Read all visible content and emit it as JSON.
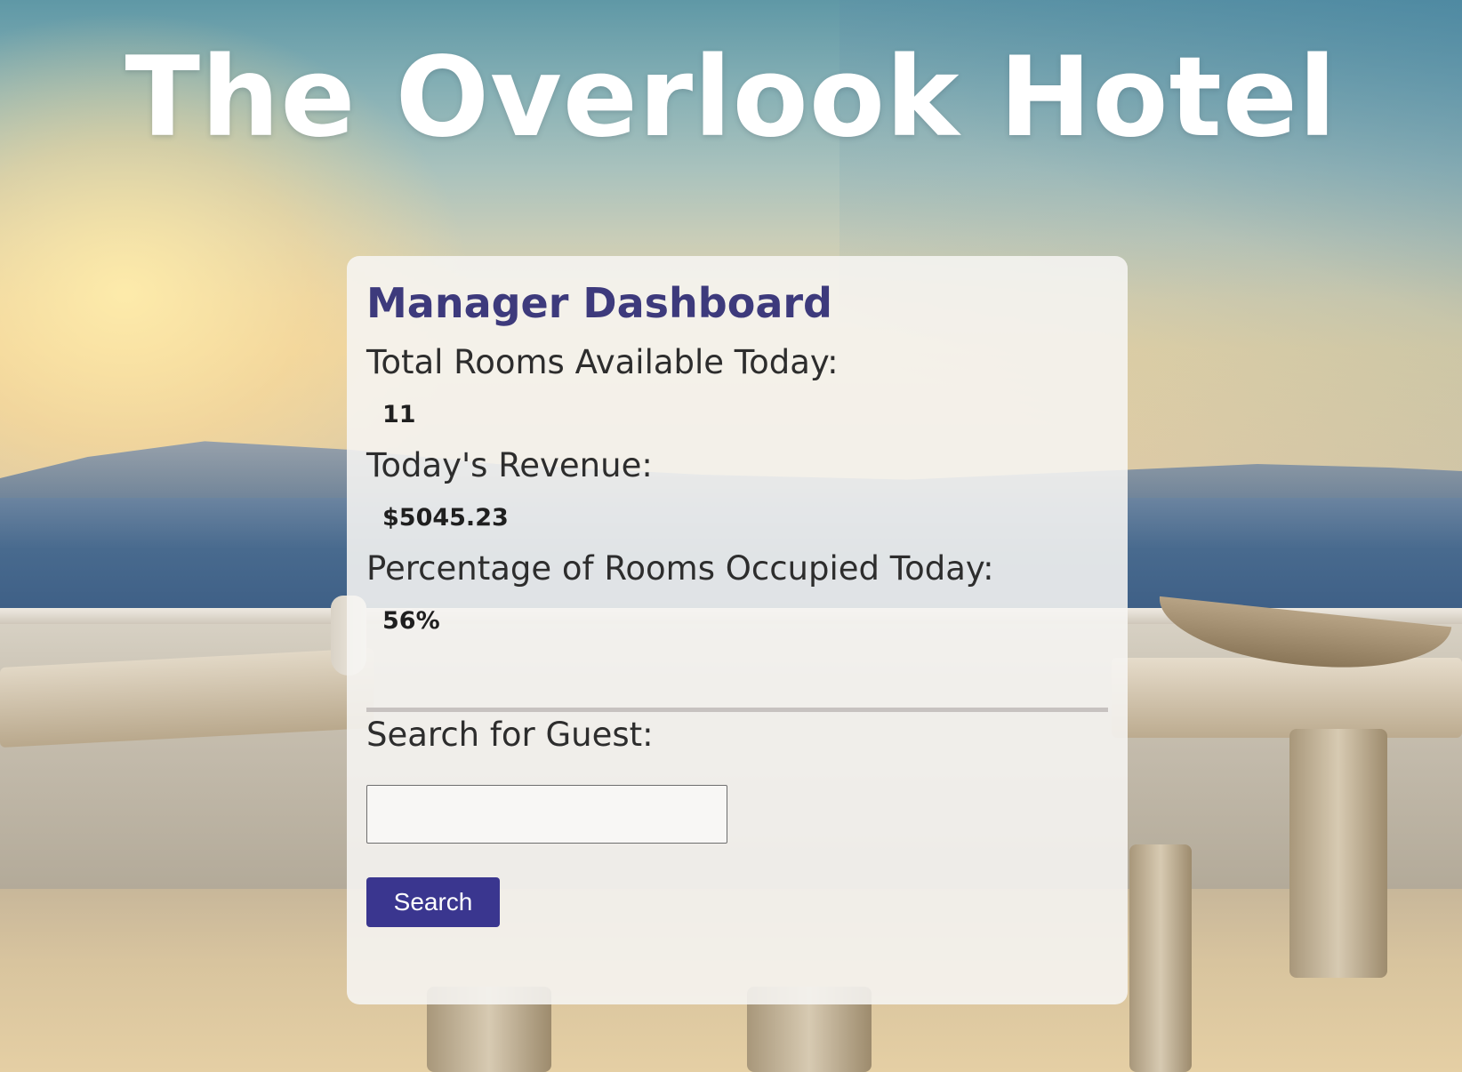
{
  "hotel": {
    "title": "The Overlook Hotel"
  },
  "dashboard": {
    "heading": "Manager Dashboard",
    "rooms_available_label": "Total Rooms Available Today:",
    "rooms_available_value": "11",
    "revenue_label": "Today's Revenue:",
    "revenue_value": "$5045.23",
    "occupancy_label": "Percentage of Rooms Occupied Today:",
    "occupancy_value": "56%"
  },
  "search": {
    "label": "Search for Guest:",
    "input_value": "",
    "button_label": "Search"
  },
  "colors": {
    "heading": "#3d3a7c",
    "button": "#3a368f"
  }
}
